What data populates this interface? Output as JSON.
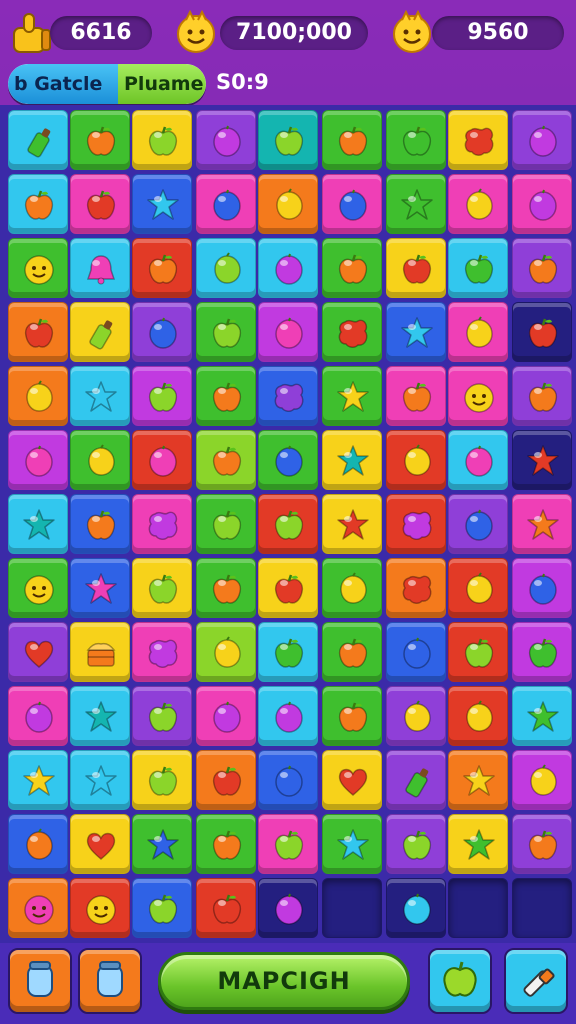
{
  "hud": {
    "moves": "6616",
    "score": "7100;000",
    "coins": "9560"
  },
  "level": {
    "left_label": "b Gatcle",
    "right_label": "Pluame",
    "score": "S0:9"
  },
  "bottom": {
    "main_button_label": "MAPCIGH"
  },
  "colors": {
    "cyan": "#32c7ee",
    "green": "#3fbf2e",
    "lime": "#8bd52a",
    "yellow": "#f7d21a",
    "orange": "#f47a1c",
    "red": "#e23a26",
    "pink": "#ef3fb6",
    "magenta": "#c13ae0",
    "purple": "#8f3fd8",
    "blue": "#2f62e6",
    "navy": "#241f80",
    "teal": "#14b5b0"
  },
  "board": [
    [
      [
        "cyan",
        "bottle",
        "green"
      ],
      [
        "green",
        "apple",
        "orange"
      ],
      [
        "yellow",
        "apple",
        "lime"
      ],
      [
        "purple",
        "plum",
        "magenta"
      ],
      [
        "teal",
        "apple",
        "lime"
      ],
      [
        "green",
        "apple",
        "orange"
      ],
      [
        "green",
        "apple",
        "green"
      ],
      [
        "yellow",
        "blob",
        "red"
      ],
      [
        "purple",
        "plum",
        "magenta"
      ]
    ],
    [
      [
        "cyan",
        "apple",
        "orange"
      ],
      [
        "pink",
        "apple",
        "red"
      ],
      [
        "blue",
        "star",
        "cyan"
      ],
      [
        "pink",
        "plum",
        "blue"
      ],
      [
        "orange",
        "lemon",
        "yellow"
      ],
      [
        "pink",
        "plum",
        "blue"
      ],
      [
        "green",
        "star",
        "green"
      ],
      [
        "pink",
        "lemon",
        "yellow"
      ],
      [
        "pink",
        "plum",
        "magenta"
      ]
    ],
    [
      [
        "green",
        "face",
        "yellow"
      ],
      [
        "cyan",
        "bell",
        "pink"
      ],
      [
        "red",
        "apple",
        "orange"
      ],
      [
        "cyan",
        "lemon",
        "lime"
      ],
      [
        "cyan",
        "plum",
        "magenta"
      ],
      [
        "green",
        "apple",
        "orange"
      ],
      [
        "yellow",
        "apple",
        "red"
      ],
      [
        "cyan",
        "apple",
        "green"
      ],
      [
        "purple",
        "apple",
        "orange"
      ]
    ],
    [
      [
        "orange",
        "apple",
        "red"
      ],
      [
        "yellow",
        "bottle",
        "lime"
      ],
      [
        "purple",
        "plum",
        "blue"
      ],
      [
        "green",
        "apple",
        "lime"
      ],
      [
        "magenta",
        "plum",
        "pink"
      ],
      [
        "green",
        "blob",
        "red"
      ],
      [
        "blue",
        "star",
        "cyan"
      ],
      [
        "pink",
        "lemon",
        "yellow"
      ],
      [
        "navy",
        "apple",
        "red"
      ]
    ],
    [
      [
        "orange",
        "lemon",
        "yellow"
      ],
      [
        "cyan",
        "star",
        "cyan"
      ],
      [
        "magenta",
        "apple",
        "lime"
      ],
      [
        "green",
        "apple",
        "orange"
      ],
      [
        "blue",
        "blob",
        "purple"
      ],
      [
        "green",
        "star",
        "yellow"
      ],
      [
        "pink",
        "apple",
        "orange"
      ],
      [
        "pink",
        "face",
        "yellow"
      ],
      [
        "purple",
        "apple",
        "orange"
      ]
    ],
    [
      [
        "magenta",
        "plum",
        "pink"
      ],
      [
        "green",
        "lemon",
        "yellow"
      ],
      [
        "red",
        "plum",
        "pink"
      ],
      [
        "lime",
        "apple",
        "orange"
      ],
      [
        "green",
        "plum",
        "blue"
      ],
      [
        "yellow",
        "star",
        "teal"
      ],
      [
        "red",
        "lemon",
        "yellow"
      ],
      [
        "cyan",
        "plum",
        "pink"
      ],
      [
        "navy",
        "star",
        "red"
      ]
    ],
    [
      [
        "cyan",
        "star",
        "teal"
      ],
      [
        "blue",
        "apple",
        "orange"
      ],
      [
        "pink",
        "blob",
        "magenta"
      ],
      [
        "green",
        "apple",
        "lime"
      ],
      [
        "red",
        "apple",
        "lime"
      ],
      [
        "yellow",
        "star",
        "red"
      ],
      [
        "red",
        "blob",
        "magenta"
      ],
      [
        "purple",
        "plum",
        "blue"
      ],
      [
        "pink",
        "star",
        "orange"
      ]
    ],
    [
      [
        "green",
        "face",
        "yellow"
      ],
      [
        "blue",
        "star",
        "pink"
      ],
      [
        "yellow",
        "apple",
        "lime"
      ],
      [
        "green",
        "apple",
        "orange"
      ],
      [
        "yellow",
        "apple",
        "red"
      ],
      [
        "green",
        "lemon",
        "yellow"
      ],
      [
        "orange",
        "blob",
        "red"
      ],
      [
        "red",
        "lemon",
        "yellow"
      ],
      [
        "magenta",
        "plum",
        "blue"
      ]
    ],
    [
      [
        "purple",
        "heart",
        "red"
      ],
      [
        "yellow",
        "cake",
        "orange"
      ],
      [
        "pink",
        "blob",
        "magenta"
      ],
      [
        "lime",
        "lemon",
        "yellow"
      ],
      [
        "cyan",
        "apple",
        "green"
      ],
      [
        "green",
        "apple",
        "orange"
      ],
      [
        "blue",
        "plum",
        "blue"
      ],
      [
        "red",
        "apple",
        "lime"
      ],
      [
        "magenta",
        "apple",
        "green"
      ]
    ],
    [
      [
        "pink",
        "plum",
        "magenta"
      ],
      [
        "cyan",
        "star",
        "teal"
      ],
      [
        "purple",
        "apple",
        "lime"
      ],
      [
        "pink",
        "plum",
        "magenta"
      ],
      [
        "cyan",
        "plum",
        "magenta"
      ],
      [
        "green",
        "apple",
        "orange"
      ],
      [
        "purple",
        "lemon",
        "yellow"
      ],
      [
        "red",
        "lemon",
        "yellow"
      ],
      [
        "cyan",
        "star",
        "green"
      ]
    ],
    [
      [
        "cyan",
        "star",
        "yellow"
      ],
      [
        "cyan",
        "star",
        "cyan"
      ],
      [
        "yellow",
        "apple",
        "lime"
      ],
      [
        "orange",
        "apple",
        "red"
      ],
      [
        "blue",
        "plum",
        "blue"
      ],
      [
        "yellow",
        "heart",
        "red"
      ],
      [
        "purple",
        "bottle",
        "green"
      ],
      [
        "orange",
        "star",
        "yellow"
      ],
      [
        "magenta",
        "lemon",
        "yellow"
      ]
    ],
    [
      [
        "blue",
        "lemon",
        "orange"
      ],
      [
        "yellow",
        "heart",
        "red"
      ],
      [
        "green",
        "star",
        "blue"
      ],
      [
        "green",
        "apple",
        "orange"
      ],
      [
        "pink",
        "apple",
        "lime"
      ],
      [
        "green",
        "star",
        "cyan"
      ],
      [
        "purple",
        "apple",
        "lime"
      ],
      [
        "yellow",
        "star",
        "green"
      ],
      [
        "purple",
        "apple",
        "orange"
      ]
    ],
    [
      [
        "orange",
        "face",
        "pink"
      ],
      [
        "red",
        "face",
        "yellow"
      ],
      [
        "blue",
        "apple",
        "lime"
      ],
      [
        "red",
        "apple",
        "red"
      ],
      [
        "navy",
        "plum",
        "magenta"
      ],
      [
        "empty",
        "",
        ""
      ],
      [
        "navy",
        "plum",
        "cyan"
      ],
      [
        "empty",
        "",
        ""
      ],
      [
        "empty",
        "",
        ""
      ]
    ]
  ],
  "tools": [
    {
      "name": "jar",
      "color": "orange"
    },
    {
      "name": "jar",
      "color": "orange"
    },
    {
      "name": "apple",
      "color": "cyan"
    },
    {
      "name": "brush",
      "color": "cyan"
    }
  ]
}
